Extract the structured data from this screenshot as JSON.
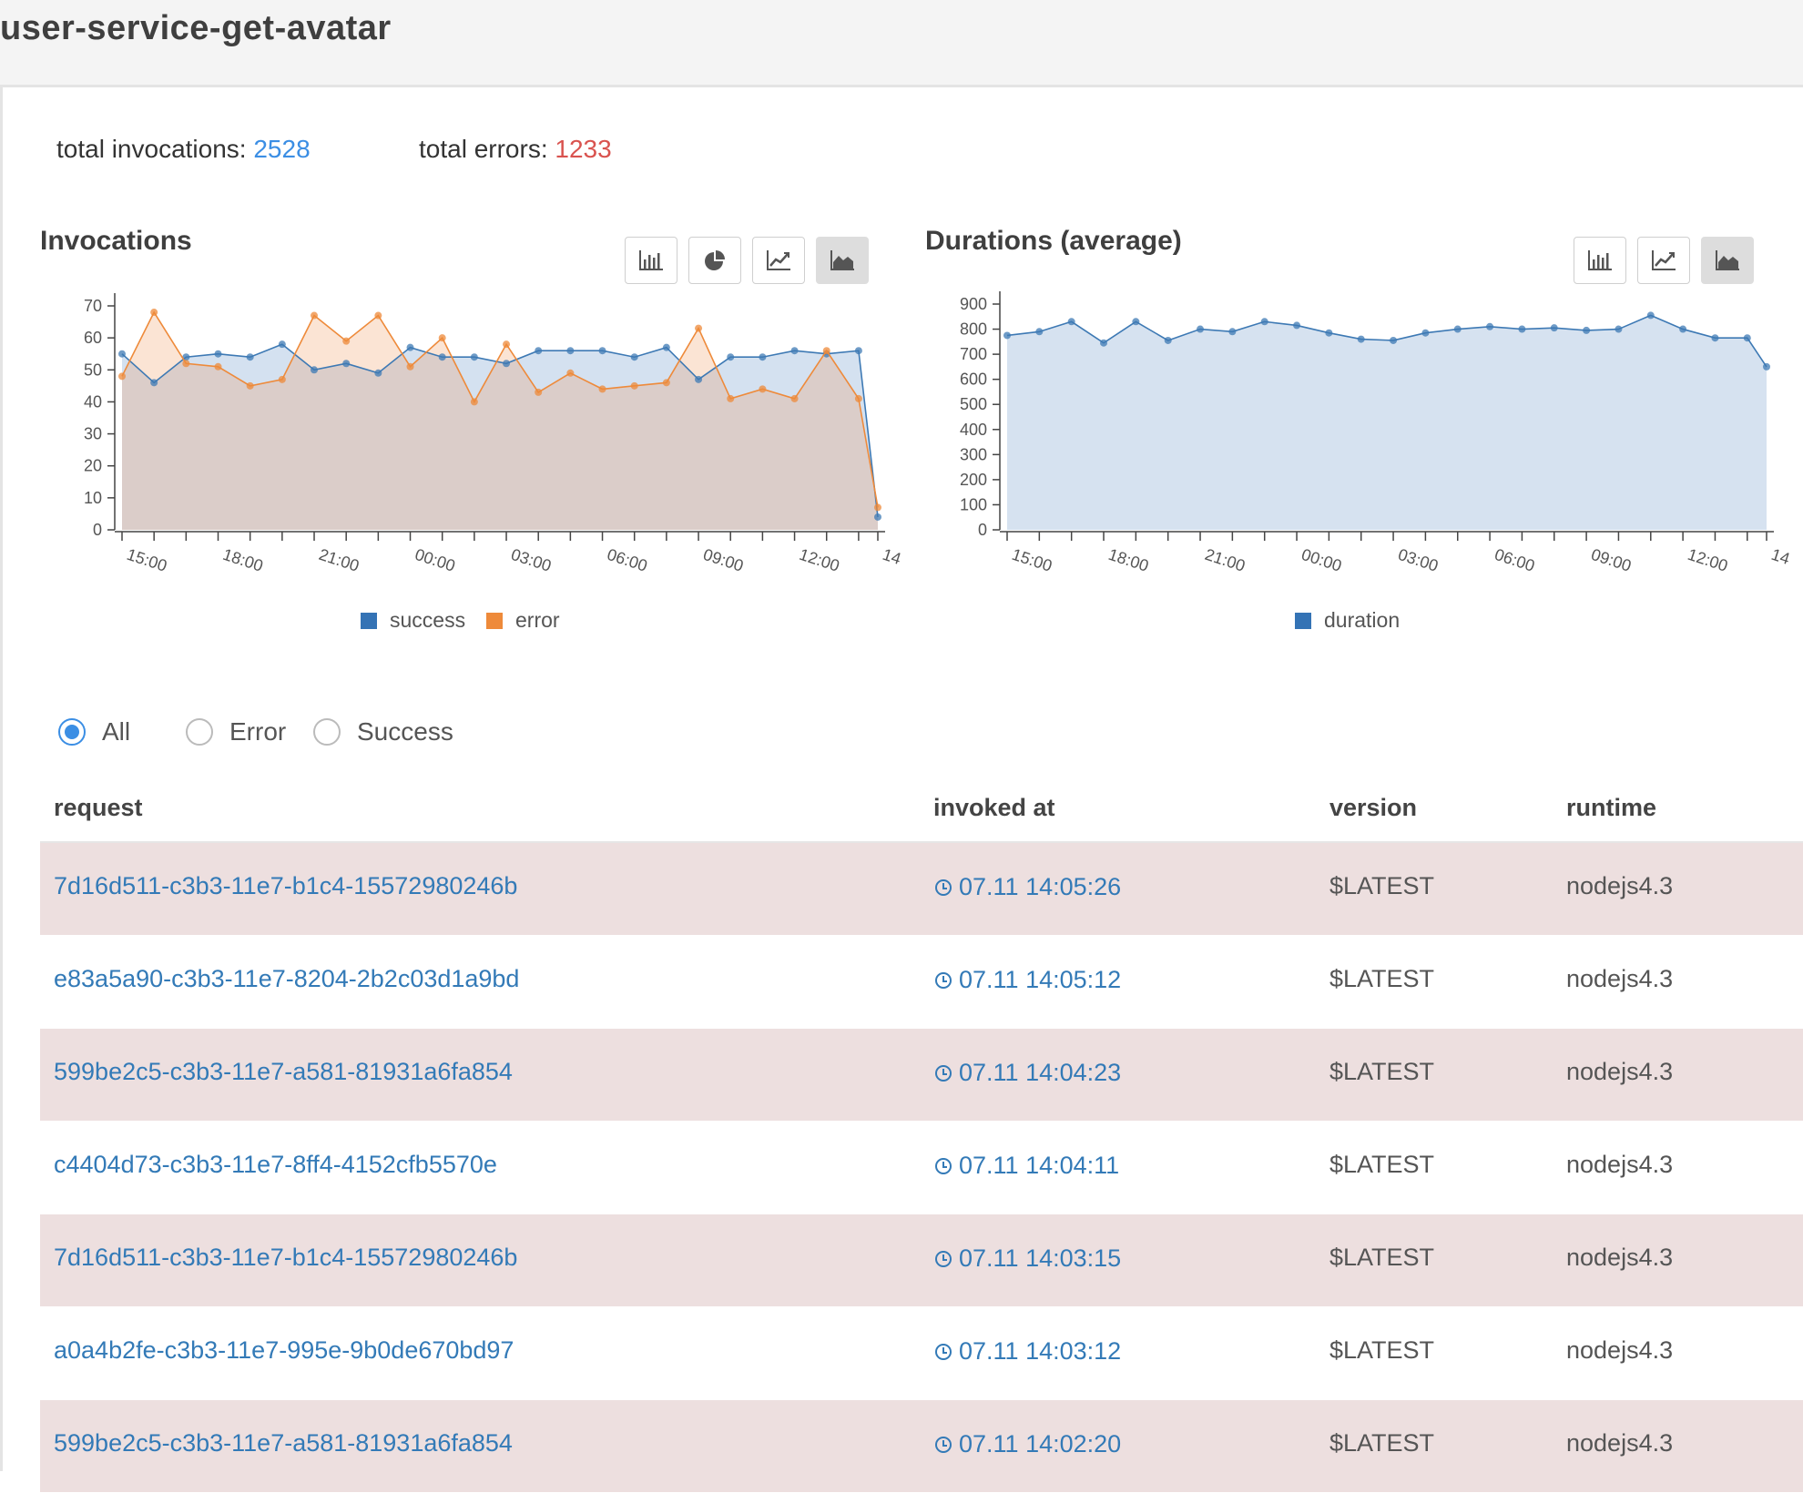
{
  "header": {
    "title": "user-service-get-avatar"
  },
  "totals": {
    "invocations_label": "total invocations:",
    "invocations_value": "2528",
    "errors_label": "total errors:",
    "errors_value": "1233"
  },
  "colors": {
    "success": "#3473b5",
    "error": "#ee8a3a",
    "link": "#337ab7",
    "error_row": "#eddfdf",
    "accent": "#3b8ee4"
  },
  "invocations_chart": {
    "title": "Invocations",
    "buttons": [
      {
        "icon": "bar-chart-icon",
        "active": false
      },
      {
        "icon": "pie-chart-icon",
        "active": false
      },
      {
        "icon": "line-chart-icon",
        "active": false
      },
      {
        "icon": "area-chart-icon",
        "active": true
      }
    ],
    "legend": [
      "success",
      "error"
    ]
  },
  "durations_chart": {
    "title": "Durations (average)",
    "buttons": [
      {
        "icon": "bar-chart-icon",
        "active": false
      },
      {
        "icon": "line-chart-icon",
        "active": false
      },
      {
        "icon": "area-chart-icon",
        "active": true
      }
    ],
    "legend": [
      "duration"
    ]
  },
  "chart_data": [
    {
      "type": "area",
      "title": "Invocations",
      "xlabel": "",
      "ylabel": "",
      "ylim": [
        0,
        70
      ],
      "yticks": [
        0,
        10,
        20,
        30,
        40,
        50,
        60,
        70
      ],
      "x": [
        0,
        1,
        2,
        3,
        4,
        5,
        6,
        7,
        8,
        9,
        10,
        11,
        12,
        13,
        14,
        15,
        16,
        17,
        18,
        19,
        20,
        21,
        22,
        23,
        23.6
      ],
      "xtick_labels": [
        "15:00",
        "18:00",
        "21:00",
        "00:00",
        "03:00",
        "06:00",
        "09:00",
        "12:00",
        "14"
      ],
      "series": [
        {
          "name": "success",
          "values": [
            55,
            46,
            54,
            55,
            54,
            58,
            50,
            52,
            49,
            57,
            54,
            54,
            52,
            56,
            56,
            56,
            54,
            57,
            47,
            54,
            54,
            56,
            55,
            56,
            4
          ]
        },
        {
          "name": "error",
          "values": [
            48,
            68,
            52,
            51,
            45,
            47,
            67,
            59,
            67,
            51,
            60,
            40,
            58,
            43,
            49,
            44,
            45,
            46,
            63,
            41,
            44,
            41,
            56,
            41,
            7
          ]
        }
      ],
      "legend": "bottom",
      "grid": false
    },
    {
      "type": "area",
      "title": "Durations (average)",
      "xlabel": "",
      "ylabel": "",
      "ylim": [
        0,
        900
      ],
      "yticks": [
        0,
        100,
        200,
        300,
        400,
        500,
        600,
        700,
        800,
        900
      ],
      "x": [
        0,
        1,
        2,
        3,
        4,
        5,
        6,
        7,
        8,
        9,
        10,
        11,
        12,
        13,
        14,
        15,
        16,
        17,
        18,
        19,
        20,
        21,
        22,
        23,
        23.6
      ],
      "xtick_labels": [
        "15:00",
        "18:00",
        "21:00",
        "00:00",
        "03:00",
        "06:00",
        "09:00",
        "12:00",
        "14"
      ],
      "series": [
        {
          "name": "duration",
          "values": [
            775,
            790,
            830,
            745,
            830,
            755,
            800,
            790,
            830,
            815,
            785,
            760,
            755,
            785,
            800,
            810,
            800,
            805,
            795,
            800,
            855,
            800,
            765,
            765,
            650
          ]
        }
      ],
      "legend": "bottom",
      "grid": false
    }
  ],
  "filters": {
    "options": [
      {
        "label": "All",
        "checked": true
      },
      {
        "label": "Error",
        "checked": false
      },
      {
        "label": "Success",
        "checked": false
      }
    ]
  },
  "table": {
    "columns": [
      "request",
      "invoked at",
      "version",
      "runtime"
    ],
    "rows": [
      {
        "request": "7d16d511-c3b3-11e7-b1c4-15572980246b",
        "invoked_at": "07.11 14:05:26",
        "version": "$LATEST",
        "runtime": "nodejs4.3",
        "status": "error"
      },
      {
        "request": "e83a5a90-c3b3-11e7-8204-2b2c03d1a9bd",
        "invoked_at": "07.11 14:05:12",
        "version": "$LATEST",
        "runtime": "nodejs4.3",
        "status": "success"
      },
      {
        "request": "599be2c5-c3b3-11e7-a581-81931a6fa854",
        "invoked_at": "07.11 14:04:23",
        "version": "$LATEST",
        "runtime": "nodejs4.3",
        "status": "error"
      },
      {
        "request": "c4404d73-c3b3-11e7-8ff4-4152cfb5570e",
        "invoked_at": "07.11 14:04:11",
        "version": "$LATEST",
        "runtime": "nodejs4.3",
        "status": "success"
      },
      {
        "request": "7d16d511-c3b3-11e7-b1c4-15572980246b",
        "invoked_at": "07.11 14:03:15",
        "version": "$LATEST",
        "runtime": "nodejs4.3",
        "status": "error"
      },
      {
        "request": "a0a4b2fe-c3b3-11e7-995e-9b0de670bd97",
        "invoked_at": "07.11 14:03:12",
        "version": "$LATEST",
        "runtime": "nodejs4.3",
        "status": "success"
      },
      {
        "request": "599be2c5-c3b3-11e7-a581-81931a6fa854",
        "invoked_at": "07.11 14:02:20",
        "version": "$LATEST",
        "runtime": "nodejs4.3",
        "status": "error"
      }
    ]
  }
}
